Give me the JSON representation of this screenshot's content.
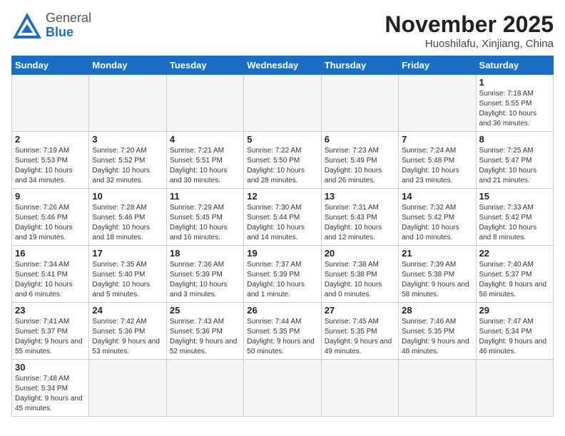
{
  "header": {
    "logo_general": "General",
    "logo_blue": "Blue",
    "month_title": "November 2025",
    "location": "Huoshilafu, Xinjiang, China"
  },
  "weekdays": [
    "Sunday",
    "Monday",
    "Tuesday",
    "Wednesday",
    "Thursday",
    "Friday",
    "Saturday"
  ],
  "weeks": [
    [
      {
        "day": "",
        "info": ""
      },
      {
        "day": "",
        "info": ""
      },
      {
        "day": "",
        "info": ""
      },
      {
        "day": "",
        "info": ""
      },
      {
        "day": "",
        "info": ""
      },
      {
        "day": "",
        "info": ""
      },
      {
        "day": "1",
        "info": "Sunrise: 7:18 AM\nSunset: 5:55 PM\nDaylight: 10 hours and 36 minutes."
      }
    ],
    [
      {
        "day": "2",
        "info": "Sunrise: 7:19 AM\nSunset: 5:53 PM\nDaylight: 10 hours and 34 minutes."
      },
      {
        "day": "3",
        "info": "Sunrise: 7:20 AM\nSunset: 5:52 PM\nDaylight: 10 hours and 32 minutes."
      },
      {
        "day": "4",
        "info": "Sunrise: 7:21 AM\nSunset: 5:51 PM\nDaylight: 10 hours and 30 minutes."
      },
      {
        "day": "5",
        "info": "Sunrise: 7:22 AM\nSunset: 5:50 PM\nDaylight: 10 hours and 28 minutes."
      },
      {
        "day": "6",
        "info": "Sunrise: 7:23 AM\nSunset: 5:49 PM\nDaylight: 10 hours and 26 minutes."
      },
      {
        "day": "7",
        "info": "Sunrise: 7:24 AM\nSunset: 5:48 PM\nDaylight: 10 hours and 23 minutes."
      },
      {
        "day": "8",
        "info": "Sunrise: 7:25 AM\nSunset: 5:47 PM\nDaylight: 10 hours and 21 minutes."
      }
    ],
    [
      {
        "day": "9",
        "info": "Sunrise: 7:26 AM\nSunset: 5:46 PM\nDaylight: 10 hours and 19 minutes."
      },
      {
        "day": "10",
        "info": "Sunrise: 7:28 AM\nSunset: 5:46 PM\nDaylight: 10 hours and 18 minutes."
      },
      {
        "day": "11",
        "info": "Sunrise: 7:29 AM\nSunset: 5:45 PM\nDaylight: 10 hours and 16 minutes."
      },
      {
        "day": "12",
        "info": "Sunrise: 7:30 AM\nSunset: 5:44 PM\nDaylight: 10 hours and 14 minutes."
      },
      {
        "day": "13",
        "info": "Sunrise: 7:31 AM\nSunset: 5:43 PM\nDaylight: 10 hours and 12 minutes."
      },
      {
        "day": "14",
        "info": "Sunrise: 7:32 AM\nSunset: 5:42 PM\nDaylight: 10 hours and 10 minutes."
      },
      {
        "day": "15",
        "info": "Sunrise: 7:33 AM\nSunset: 5:42 PM\nDaylight: 10 hours and 8 minutes."
      }
    ],
    [
      {
        "day": "16",
        "info": "Sunrise: 7:34 AM\nSunset: 5:41 PM\nDaylight: 10 hours and 6 minutes."
      },
      {
        "day": "17",
        "info": "Sunrise: 7:35 AM\nSunset: 5:40 PM\nDaylight: 10 hours and 5 minutes."
      },
      {
        "day": "18",
        "info": "Sunrise: 7:36 AM\nSunset: 5:39 PM\nDaylight: 10 hours and 3 minutes."
      },
      {
        "day": "19",
        "info": "Sunrise: 7:37 AM\nSunset: 5:39 PM\nDaylight: 10 hours and 1 minute."
      },
      {
        "day": "20",
        "info": "Sunrise: 7:38 AM\nSunset: 5:38 PM\nDaylight: 10 hours and 0 minutes."
      },
      {
        "day": "21",
        "info": "Sunrise: 7:39 AM\nSunset: 5:38 PM\nDaylight: 9 hours and 58 minutes."
      },
      {
        "day": "22",
        "info": "Sunrise: 7:40 AM\nSunset: 5:37 PM\nDaylight: 9 hours and 56 minutes."
      }
    ],
    [
      {
        "day": "23",
        "info": "Sunrise: 7:41 AM\nSunset: 5:37 PM\nDaylight: 9 hours and 55 minutes."
      },
      {
        "day": "24",
        "info": "Sunrise: 7:42 AM\nSunset: 5:36 PM\nDaylight: 9 hours and 53 minutes."
      },
      {
        "day": "25",
        "info": "Sunrise: 7:43 AM\nSunset: 5:36 PM\nDaylight: 9 hours and 52 minutes."
      },
      {
        "day": "26",
        "info": "Sunrise: 7:44 AM\nSunset: 5:35 PM\nDaylight: 9 hours and 50 minutes."
      },
      {
        "day": "27",
        "info": "Sunrise: 7:45 AM\nSunset: 5:35 PM\nDaylight: 9 hours and 49 minutes."
      },
      {
        "day": "28",
        "info": "Sunrise: 7:46 AM\nSunset: 5:35 PM\nDaylight: 9 hours and 48 minutes."
      },
      {
        "day": "29",
        "info": "Sunrise: 7:47 AM\nSunset: 5:34 PM\nDaylight: 9 hours and 46 minutes."
      }
    ],
    [
      {
        "day": "30",
        "info": "Sunrise: 7:48 AM\nSunset: 5:34 PM\nDaylight: 9 hours and 45 minutes."
      },
      {
        "day": "",
        "info": ""
      },
      {
        "day": "",
        "info": ""
      },
      {
        "day": "",
        "info": ""
      },
      {
        "day": "",
        "info": ""
      },
      {
        "day": "",
        "info": ""
      },
      {
        "day": "",
        "info": ""
      }
    ]
  ]
}
